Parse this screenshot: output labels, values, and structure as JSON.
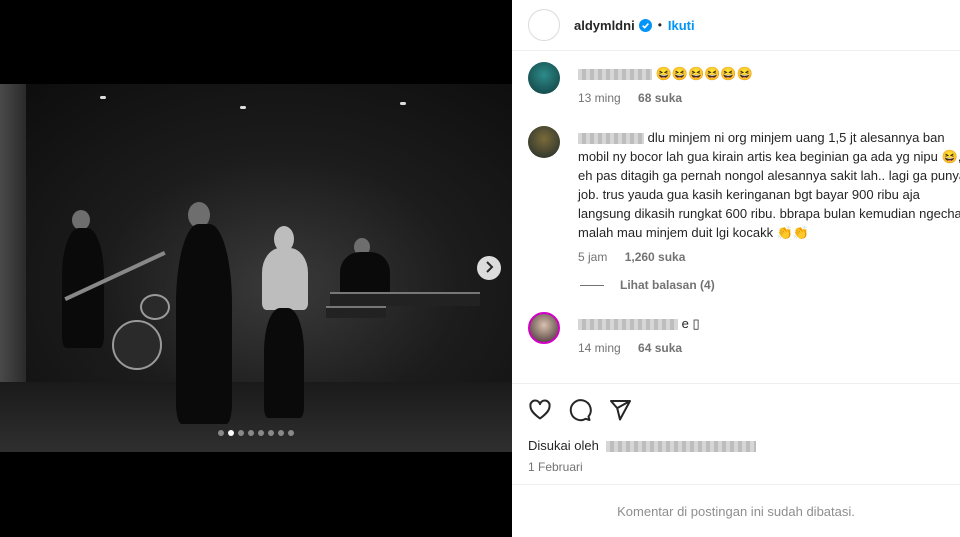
{
  "post": {
    "username": "aldymldni",
    "separator": "•",
    "follow_label": "Ikuti",
    "media": {
      "slide_count": 8,
      "active_slide": 1
    },
    "comments": [
      {
        "text_suffix": "😆😆😆😆😆😆",
        "time": "13 ming",
        "likes": "68 suka"
      },
      {
        "text": "dlu minjem ni org minjem uang 1,5 jt alesannya ban mobil ny bocor lah gua kirain artis kea beginian ga ada yg nipu 😆, eh pas ditagih ga pernah nongol alesannya sakit lah.. lagi ga punya job. trus yauda gua kasih keringanan bgt bayar 900 ribu aja langsung dikasih rungkat 600 ribu. bbrapa bulan kemudian ngechat malah mau minjem duit lgi kocakk 👏👏",
        "time": "5 jam",
        "likes": "1,260 suka",
        "replies_label": "Lihat balasan (4)"
      },
      {
        "text_suffix": "e ▯",
        "time": "14 ming",
        "likes": "64 suka"
      }
    ],
    "liked_by_prefix": "Disukai oleh",
    "date": "1 Februari",
    "comments_limited": "Komentar di postingan ini sudah dibatasi."
  },
  "colors": {
    "accent": "#0095f6",
    "verified": "#0095f6",
    "muted": "#737373"
  },
  "icons": [
    "verified-badge-icon",
    "chevron-right-icon",
    "heart-icon",
    "comment-icon",
    "share-icon"
  ]
}
